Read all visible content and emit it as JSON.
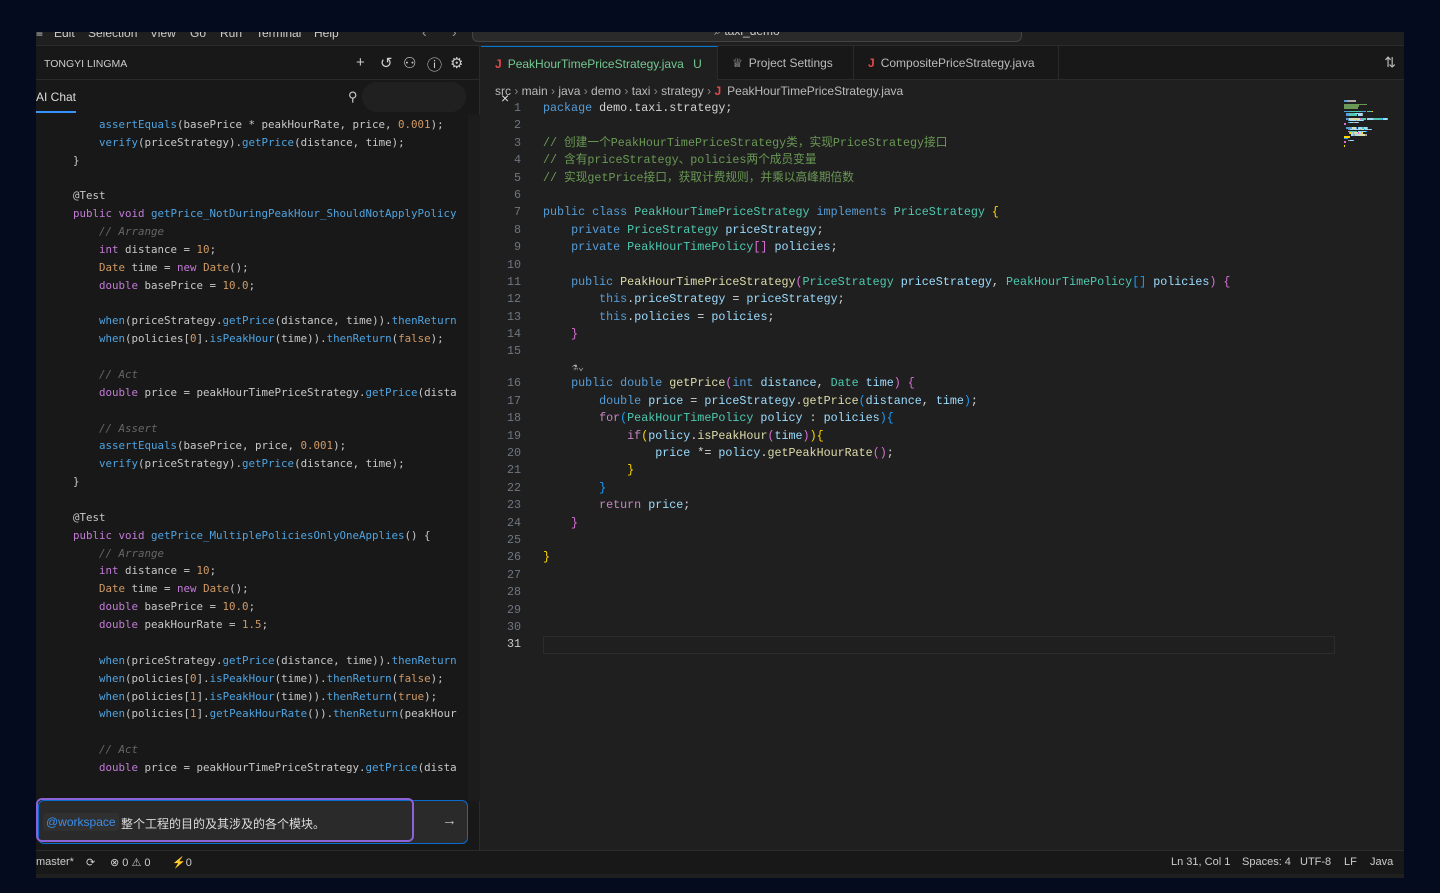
{
  "menu": {
    "items": [
      "Edit",
      "Selection",
      "View",
      "Go",
      "Run",
      "Terminal",
      "Help"
    ],
    "search": "taxi_demo"
  },
  "left": {
    "title": "TONGYI LINGMA",
    "tab": "AI Chat",
    "icons": [
      "plus-icon",
      "history-icon",
      "feedback-icon",
      "help-icon",
      "gear-icon"
    ],
    "code": [
      [
        [
          "lpl",
          "        "
        ],
        [
          "lfn",
          "assertEquals"
        ],
        [
          "lpl",
          "(basePrice * peakHourRate, price, "
        ],
        [
          "lnu",
          "0.001"
        ],
        [
          "lpl",
          ");"
        ]
      ],
      [
        [
          "lpl",
          "        "
        ],
        [
          "lfn",
          "verify"
        ],
        [
          "lpl",
          "(priceStrategy)."
        ],
        [
          "lfn",
          "getPrice"
        ],
        [
          "lpl",
          "(distance, time);"
        ]
      ],
      [
        [
          "lpl",
          "    }"
        ]
      ],
      [],
      [
        [
          "lan",
          "    @Test"
        ]
      ],
      [
        [
          "lpl",
          "    "
        ],
        [
          "lkw",
          "public void "
        ],
        [
          "lfn",
          "getPrice_NotDuringPeakHour_ShouldNotApplyPolicy"
        ]
      ],
      [
        [
          "lcm",
          "        // Arrange"
        ]
      ],
      [
        [
          "lpl",
          "        "
        ],
        [
          "lkw",
          "int"
        ],
        [
          "lpl",
          " distance = "
        ],
        [
          "lnu",
          "10"
        ],
        [
          "lpl",
          ";"
        ]
      ],
      [
        [
          "lpl",
          "        "
        ],
        [
          "lty",
          "Date"
        ],
        [
          "lpl",
          " time = "
        ],
        [
          "lkw",
          "new "
        ],
        [
          "lty",
          "Date"
        ],
        [
          "lpl",
          "();"
        ]
      ],
      [
        [
          "lpl",
          "        "
        ],
        [
          "lkw",
          "double"
        ],
        [
          "lpl",
          " basePrice = "
        ],
        [
          "lnu",
          "10.0"
        ],
        [
          "lpl",
          ";"
        ]
      ],
      [],
      [
        [
          "lpl",
          "        "
        ],
        [
          "lfn",
          "when"
        ],
        [
          "lpl",
          "(priceStrategy."
        ],
        [
          "lfn",
          "getPrice"
        ],
        [
          "lpl",
          "(distance, time))."
        ],
        [
          "lfn",
          "thenReturn"
        ]
      ],
      [
        [
          "lpl",
          "        "
        ],
        [
          "lfn",
          "when"
        ],
        [
          "lpl",
          "(policies["
        ],
        [
          "lnu",
          "0"
        ],
        [
          "lpl",
          "]."
        ],
        [
          "lfn",
          "isPeakHour"
        ],
        [
          "lpl",
          "(time))."
        ],
        [
          "lfn",
          "thenReturn"
        ],
        [
          "lpl",
          "("
        ],
        [
          "lnu",
          "false"
        ],
        [
          "lpl",
          ");"
        ]
      ],
      [],
      [
        [
          "lcm",
          "        // Act"
        ]
      ],
      [
        [
          "lpl",
          "        "
        ],
        [
          "lkw",
          "double"
        ],
        [
          "lpl",
          " price = peakHourTimePriceStrategy."
        ],
        [
          "lfn",
          "getPrice"
        ],
        [
          "lpl",
          "(dista"
        ]
      ],
      [],
      [
        [
          "lcm",
          "        // Assert"
        ]
      ],
      [
        [
          "lpl",
          "        "
        ],
        [
          "lfn",
          "assertEquals"
        ],
        [
          "lpl",
          "(basePrice, price, "
        ],
        [
          "lnu",
          "0.001"
        ],
        [
          "lpl",
          ");"
        ]
      ],
      [
        [
          "lpl",
          "        "
        ],
        [
          "lfn",
          "verify"
        ],
        [
          "lpl",
          "(priceStrategy)."
        ],
        [
          "lfn",
          "getPrice"
        ],
        [
          "lpl",
          "(distance, time);"
        ]
      ],
      [
        [
          "lpl",
          "    }"
        ]
      ],
      [],
      [
        [
          "lan",
          "    @Test"
        ]
      ],
      [
        [
          "lpl",
          "    "
        ],
        [
          "lkw",
          "public void "
        ],
        [
          "lfn",
          "getPrice_MultiplePoliciesOnlyOneApplies"
        ],
        [
          "lpl",
          "() {"
        ]
      ],
      [
        [
          "lcm",
          "        // Arrange"
        ]
      ],
      [
        [
          "lpl",
          "        "
        ],
        [
          "lkw",
          "int"
        ],
        [
          "lpl",
          " distance = "
        ],
        [
          "lnu",
          "10"
        ],
        [
          "lpl",
          ";"
        ]
      ],
      [
        [
          "lpl",
          "        "
        ],
        [
          "lty",
          "Date"
        ],
        [
          "lpl",
          " time = "
        ],
        [
          "lkw",
          "new "
        ],
        [
          "lty",
          "Date"
        ],
        [
          "lpl",
          "();"
        ]
      ],
      [
        [
          "lpl",
          "        "
        ],
        [
          "lkw",
          "double"
        ],
        [
          "lpl",
          " basePrice = "
        ],
        [
          "lnu",
          "10.0"
        ],
        [
          "lpl",
          ";"
        ]
      ],
      [
        [
          "lpl",
          "        "
        ],
        [
          "lkw",
          "double"
        ],
        [
          "lpl",
          " peakHourRate = "
        ],
        [
          "lnu",
          "1.5"
        ],
        [
          "lpl",
          ";"
        ]
      ],
      [],
      [
        [
          "lpl",
          "        "
        ],
        [
          "lfn",
          "when"
        ],
        [
          "lpl",
          "(priceStrategy."
        ],
        [
          "lfn",
          "getPrice"
        ],
        [
          "lpl",
          "(distance, time))."
        ],
        [
          "lfn",
          "thenReturn"
        ]
      ],
      [
        [
          "lpl",
          "        "
        ],
        [
          "lfn",
          "when"
        ],
        [
          "lpl",
          "(policies["
        ],
        [
          "lnu",
          "0"
        ],
        [
          "lpl",
          "]."
        ],
        [
          "lfn",
          "isPeakHour"
        ],
        [
          "lpl",
          "(time))."
        ],
        [
          "lfn",
          "thenReturn"
        ],
        [
          "lpl",
          "("
        ],
        [
          "lnu",
          "false"
        ],
        [
          "lpl",
          ");"
        ]
      ],
      [
        [
          "lpl",
          "        "
        ],
        [
          "lfn",
          "when"
        ],
        [
          "lpl",
          "(policies["
        ],
        [
          "lnu",
          "1"
        ],
        [
          "lpl",
          "]."
        ],
        [
          "lfn",
          "isPeakHour"
        ],
        [
          "lpl",
          "(time))."
        ],
        [
          "lfn",
          "thenReturn"
        ],
        [
          "lpl",
          "("
        ],
        [
          "lnu",
          "true"
        ],
        [
          "lpl",
          ");"
        ]
      ],
      [
        [
          "lpl",
          "        "
        ],
        [
          "lfn",
          "when"
        ],
        [
          "lpl",
          "(policies["
        ],
        [
          "lnu",
          "1"
        ],
        [
          "lpl",
          "]."
        ],
        [
          "lfn",
          "getPeakHourRate"
        ],
        [
          "lpl",
          "())."
        ],
        [
          "lfn",
          "thenReturn"
        ],
        [
          "lpl",
          "(peakHour"
        ]
      ],
      [],
      [
        [
          "lcm",
          "        // Act"
        ]
      ],
      [
        [
          "lpl",
          "        "
        ],
        [
          "lkw",
          "double"
        ],
        [
          "lpl",
          " price = peakHourTimePriceStrategy."
        ],
        [
          "lfn",
          "getPrice"
        ],
        [
          "lpl",
          "(dista"
        ]
      ]
    ],
    "input": {
      "mention": "@workspace",
      "text": "整个工程的目的及其涉及的各个模块。",
      "send_icon": "arrow-right-icon"
    }
  },
  "editor": {
    "tabs": [
      {
        "label": "PeakHourTimePriceStrategy.java",
        "badge": "U",
        "close": "×",
        "active": true,
        "icon": "java-icon"
      },
      {
        "label": "Project Settings",
        "icon": "settings-trophy-icon"
      },
      {
        "label": "CompositePriceStrategy.java",
        "icon": "java-icon"
      }
    ],
    "breadcrumb": [
      "src",
      "main",
      "java",
      "demo",
      "taxi",
      "strategy",
      "PeakHourTimePriceStrategy.java"
    ],
    "current_line": 31,
    "lens_after_line": 15,
    "lines": [
      [
        [
          "kb",
          "package"
        ],
        [
          "pl",
          " demo.taxi.strategy;"
        ]
      ],
      [],
      [
        [
          "cm",
          "// 创建一个PeakHourTimePriceStrategy类，实现PriceStrategy接口"
        ]
      ],
      [
        [
          "cm",
          "// 含有priceStrategy、policies两个成员变量"
        ]
      ],
      [
        [
          "cm",
          "// 实现getPrice接口，获取计费规则，并乘以高峰期倍数"
        ]
      ],
      [],
      [
        [
          "kb",
          "public class "
        ],
        [
          "ty",
          "PeakHourTimePriceStrategy"
        ],
        [
          "kb",
          " implements "
        ],
        [
          "ty",
          "PriceStrategy"
        ],
        [
          "br1",
          " {"
        ]
      ],
      [
        [
          "pl",
          "    "
        ],
        [
          "kb",
          "private "
        ],
        [
          "ty",
          "PriceStrategy"
        ],
        [
          "va",
          " priceStrategy"
        ],
        [
          "pl",
          ";"
        ]
      ],
      [
        [
          "pl",
          "    "
        ],
        [
          "kb",
          "private "
        ],
        [
          "ty",
          "PeakHourTimePolicy"
        ],
        [
          "br2",
          "[]"
        ],
        [
          "va",
          " policies"
        ],
        [
          "pl",
          ";"
        ]
      ],
      [],
      [
        [
          "pl",
          "    "
        ],
        [
          "kb",
          "public "
        ],
        [
          "fn",
          "PeakHourTimePriceStrategy"
        ],
        [
          "br2",
          "("
        ],
        [
          "ty",
          "PriceStrategy"
        ],
        [
          "va",
          " priceStrategy"
        ],
        [
          "pl",
          ", "
        ],
        [
          "ty",
          "PeakHourTimePolicy"
        ],
        [
          "br3",
          "[]"
        ],
        [
          "va",
          " policies"
        ],
        [
          "br2",
          ")"
        ],
        [
          "br2",
          " {"
        ]
      ],
      [
        [
          "pl",
          "        "
        ],
        [
          "kb",
          "this"
        ],
        [
          "pl",
          "."
        ],
        [
          "va",
          "priceStrategy"
        ],
        [
          "pl",
          " = "
        ],
        [
          "va",
          "priceStrategy"
        ],
        [
          "pl",
          ";"
        ]
      ],
      [
        [
          "pl",
          "        "
        ],
        [
          "kb",
          "this"
        ],
        [
          "pl",
          "."
        ],
        [
          "va",
          "policies"
        ],
        [
          "pl",
          " = "
        ],
        [
          "va",
          "policies"
        ],
        [
          "pl",
          ";"
        ]
      ],
      [
        [
          "br2",
          "    }"
        ]
      ],
      [],
      [
        [
          "pl",
          "    "
        ],
        [
          "kb",
          "public double "
        ],
        [
          "fn",
          "getPrice"
        ],
        [
          "br2",
          "("
        ],
        [
          "kb",
          "int"
        ],
        [
          "va",
          " distance"
        ],
        [
          "pl",
          ", "
        ],
        [
          "ty",
          "Date"
        ],
        [
          "va",
          " time"
        ],
        [
          "br2",
          ")"
        ],
        [
          "br2",
          " {"
        ]
      ],
      [
        [
          "pl",
          "        "
        ],
        [
          "kb",
          "double"
        ],
        [
          "va",
          " price"
        ],
        [
          "pl",
          " = "
        ],
        [
          "va",
          "priceStrategy"
        ],
        [
          "pl",
          "."
        ],
        [
          "fn",
          "getPrice"
        ],
        [
          "br3",
          "("
        ],
        [
          "va",
          "distance"
        ],
        [
          "pl",
          ", "
        ],
        [
          "va",
          "time"
        ],
        [
          "br3",
          ")"
        ],
        [
          "pl",
          ";"
        ]
      ],
      [
        [
          "pl",
          "        "
        ],
        [
          "kw",
          "for"
        ],
        [
          "br3",
          "("
        ],
        [
          "ty",
          "PeakHourTimePolicy"
        ],
        [
          "va",
          " policy"
        ],
        [
          "pl",
          " : "
        ],
        [
          "va",
          "policies"
        ],
        [
          "br3",
          ")"
        ],
        [
          "br3",
          "{"
        ]
      ],
      [
        [
          "pl",
          "            "
        ],
        [
          "kw",
          "if"
        ],
        [
          "br1",
          "("
        ],
        [
          "va",
          "policy"
        ],
        [
          "pl",
          "."
        ],
        [
          "fn",
          "isPeakHour"
        ],
        [
          "br2",
          "("
        ],
        [
          "va",
          "time"
        ],
        [
          "br2",
          ")"
        ],
        [
          "br1",
          ")"
        ],
        [
          "br1",
          "{"
        ]
      ],
      [
        [
          "pl",
          "                "
        ],
        [
          "va",
          "price"
        ],
        [
          "pl",
          " *= "
        ],
        [
          "va",
          "policy"
        ],
        [
          "pl",
          "."
        ],
        [
          "fn",
          "getPeakHourRate"
        ],
        [
          "br2",
          "()"
        ],
        [
          "pl",
          ";"
        ]
      ],
      [
        [
          "br1",
          "            }"
        ]
      ],
      [
        [
          "br3",
          "        }"
        ]
      ],
      [
        [
          "pl",
          "        "
        ],
        [
          "kw",
          "return"
        ],
        [
          "va",
          " price"
        ],
        [
          "pl",
          ";"
        ]
      ],
      [
        [
          "br2",
          "    }"
        ]
      ],
      [],
      [
        [
          "br1",
          "}"
        ]
      ],
      [],
      [],
      [],
      [],
      []
    ]
  },
  "status": {
    "branch": "master*",
    "errors": "0",
    "warnings": "0",
    "ports": "0",
    "position": "Ln 31, Col 1",
    "spaces": "Spaces: 4",
    "encoding": "UTF-8",
    "eol": "LF",
    "language": "Java"
  }
}
